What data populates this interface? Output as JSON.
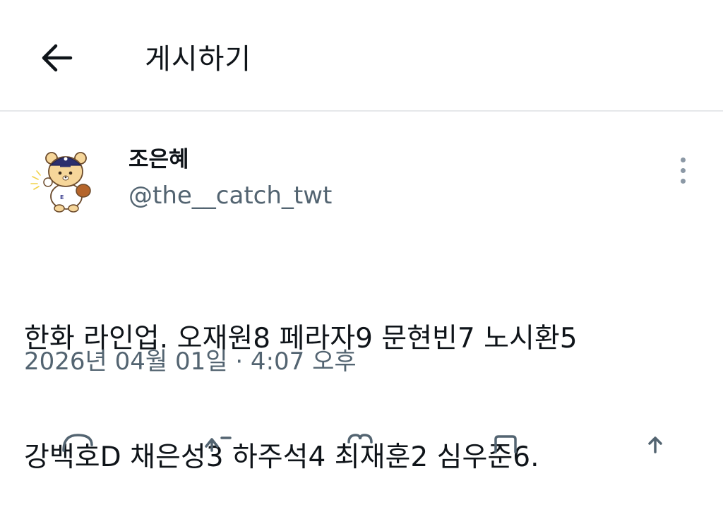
{
  "header": {
    "title": "게시하기"
  },
  "tweet": {
    "author_name": "조은혜",
    "author_handle": "@the__catch_twt",
    "text_lines": [
      "한화 라인업. 오재원8 페라자9 문현빈7 노시환5",
      "강백호D 채은성3 하주석4 최재훈2 심우준6."
    ],
    "timestamp": "2026년 04월 01일 · 4:07 오후"
  },
  "actions": [
    "reply-icon",
    "retweet-icon",
    "like-icon",
    "views-icon",
    "bookmark-icon"
  ],
  "colors": {
    "text": "#0f1419",
    "secondary": "#536471",
    "divider": "#e6e8ea"
  }
}
